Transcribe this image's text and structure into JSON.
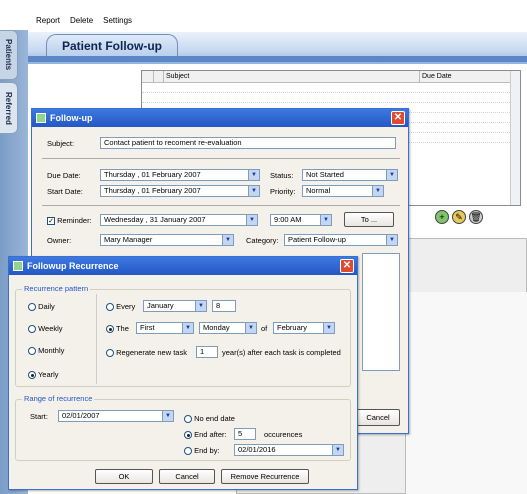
{
  "menu": [
    "Report",
    "Delete",
    "Settings"
  ],
  "side_tabs": [
    "Patients",
    "Referred"
  ],
  "tab_title": "Patient Follow-up",
  "grid": {
    "columns": [
      "Subject",
      "Due Date"
    ]
  },
  "followup": {
    "title": "Follow-up",
    "subject_label": "Subject:",
    "subject_value": "Contact patient to recoment re-evaluation",
    "due_label": "Due Date:",
    "due_value": "Thursday  , 01  February  2007",
    "start_label": "Start Date:",
    "start_value": "Thursday  , 01  February  2007",
    "status_label": "Status:",
    "status_value": "Not Started",
    "priority_label": "Priority:",
    "priority_value": "Normal",
    "reminder_label": "Reminder:",
    "reminder_checked": "✓",
    "reminder_date": "Wednesday , 31  January  2007",
    "reminder_time": "9:00 AM",
    "to_label": "To ...",
    "owner_label": "Owner:",
    "owner_value": "Mary Manager",
    "category_label": "Category:",
    "category_value": "Patient Follow-up",
    "cancel_label": "Cancel"
  },
  "recurrence": {
    "title": "Followup Recurrence",
    "pattern_title": "Recurrence pattern",
    "daily": "Daily",
    "weekly": "Weekly",
    "monthly": "Monthly",
    "yearly": "Yearly",
    "every_label": "Every",
    "every_month": "January",
    "every_day": "8",
    "the_label": "The",
    "the_ordinal": "First",
    "the_weekday": "Monday",
    "of_label": "of",
    "the_month": "February",
    "regen_label": "Regenerate new task",
    "regen_value": "1",
    "regen_suffix": "year(s) after each task is completed",
    "range_title": "Range of recurrence",
    "start_label": "Start:",
    "start_value": "02/01/2007",
    "no_end": "No end date",
    "end_after_label": "End after:",
    "end_after_value": "5",
    "occurrences": "occurences",
    "end_by_label": "End by:",
    "end_by_value": "02/01/2016",
    "ok": "OK",
    "cancel": "Cancel",
    "remove": "Remove Recurrence"
  }
}
